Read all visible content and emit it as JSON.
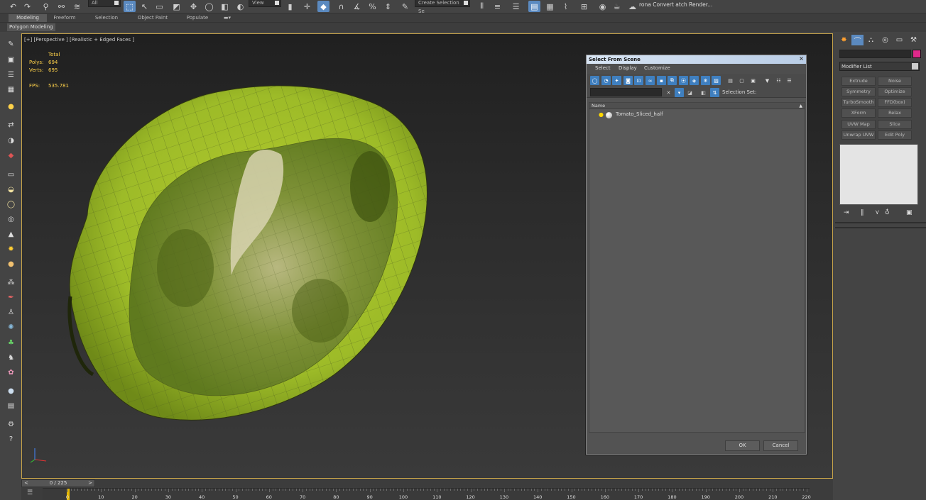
{
  "toolbar": {
    "dropdown_all": "All",
    "dropdown_view": "View",
    "create_selection_set": "Create Selection Se",
    "render_plugin": "rona Convert  atch Render..."
  },
  "ribbon": {
    "tabs": [
      "Modeling",
      "Freeform",
      "Selection",
      "Object Paint",
      "Populate"
    ],
    "selected_tab": "Modeling",
    "subpanel_label": "Polygon Modeling"
  },
  "viewport": {
    "label": "[+] [Perspective ] [Realistic + Edged Faces ]",
    "stats": {
      "total_label": "Total",
      "polys_label": "Polys:",
      "polys_value": "694",
      "verts_label": "Verts:",
      "verts_value": "695",
      "fps_label": "FPS:",
      "fps_value": "535.781"
    }
  },
  "dialog": {
    "title": "Select From Scene",
    "close": "×",
    "menu": [
      "Select",
      "Display",
      "Customize"
    ],
    "selection_set_label": "Selection Set:",
    "list_header": "Name",
    "sort_icon": "▲",
    "items": [
      "Tomato_Sliced_half"
    ],
    "ok_label": "OK",
    "cancel_label": "Cancel"
  },
  "command_panel": {
    "modifier_list_label": "Modifier List",
    "modifier_buttons": [
      "Extrude",
      "Noise",
      "Symmetry",
      "Optimize",
      "TurboSmooth",
      "FFD(box)",
      "XForm",
      "Relax",
      "UVW Map",
      "Slice",
      "Unwrap UVW",
      "Edit Poly"
    ],
    "object_color": "#e0288a"
  },
  "timeline": {
    "frame_display": "0 / 225",
    "prev_arrow": "<",
    "next_arrow": ">",
    "ticks": [
      "0",
      "10",
      "20",
      "30",
      "40",
      "50",
      "60",
      "70",
      "80",
      "90",
      "100",
      "110",
      "120",
      "130",
      "140",
      "150",
      "160",
      "170",
      "180",
      "190",
      "200",
      "210",
      "220"
    ]
  }
}
